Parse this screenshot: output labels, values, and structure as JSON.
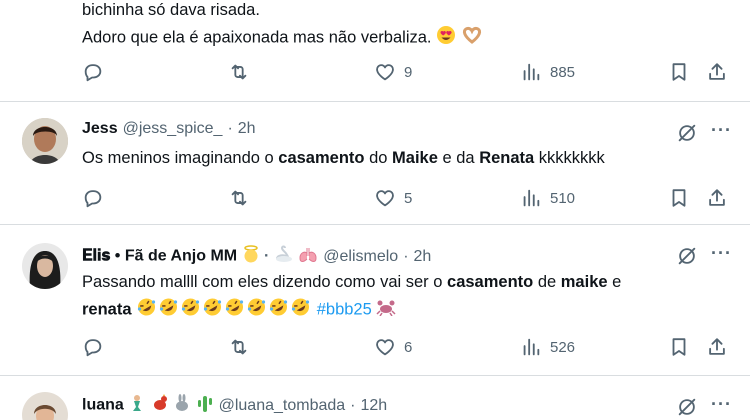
{
  "tweets": [
    {
      "lines": [
        "bichinha só dava risada.",
        "Adoro que ela é apaixonada mas não verbaliza."
      ],
      "emojis": [
        "heart-eyes-emoji",
        "heart-hands-emoji"
      ],
      "actions": {
        "replies": "",
        "retweets": "",
        "likes": "9",
        "views": "885"
      }
    },
    {
      "name": "Jess",
      "handle": "@jess_spice_",
      "dot": "·",
      "time": "2h",
      "segments": [
        {
          "t": "Os meninos imaginando o ",
          "b": false
        },
        {
          "t": "casamento",
          "b": true
        },
        {
          "t": " do ",
          "b": false
        },
        {
          "t": "Maike",
          "b": true
        },
        {
          "t": " e da ",
          "b": false
        },
        {
          "t": "Renata",
          "b": true
        },
        {
          "t": " kkkkkkkk",
          "b": false
        }
      ],
      "actions": {
        "replies": "",
        "retweets": "",
        "likes": "5",
        "views": "510"
      }
    },
    {
      "name": "𝐄𝐥𝐢𝐬 • Fã de Anjo MM",
      "handle": "@elismelo",
      "dot": "·",
      "time": "2h",
      "line1": [
        {
          "t": "Passando mallll com eles dizendo como vai ser o ",
          "b": false
        },
        {
          "t": "casamento",
          "b": true
        },
        {
          "t": " de ",
          "b": false
        },
        {
          "t": "maike",
          "b": true
        },
        {
          "t": " e",
          "b": false
        }
      ],
      "line2_bold": "renata",
      "hashtag": "#bbb25",
      "actions": {
        "replies": "",
        "retweets": "",
        "likes": "6",
        "views": "526"
      }
    },
    {
      "name": "luana",
      "handle": "@luana_tombada",
      "dot": "·",
      "time": "12h"
    }
  ],
  "colors": {
    "text": "#0f1419",
    "muted": "#536471",
    "link": "#1d9bf0",
    "separator": "#d9dde0"
  }
}
